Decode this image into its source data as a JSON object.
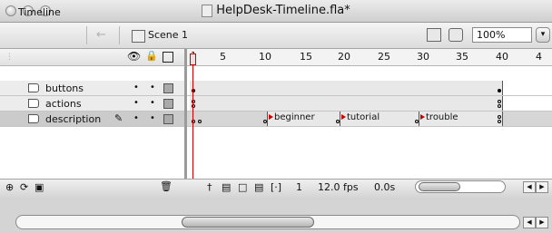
{
  "window": {
    "title": "HelpDesk-Timeline.fla*"
  },
  "toolbar": {
    "panel_tab": "Timeline",
    "scene_label": "Scene 1",
    "zoom_value": "100%"
  },
  "layer_header": {
    "eye_icon": "eye-icon",
    "lock_icon": "lock-icon",
    "outline_icon": "outline-square-icon"
  },
  "layers": [
    {
      "name": "buttons"
    },
    {
      "name": "actions"
    },
    {
      "name": "description"
    }
  ],
  "ruler": {
    "ticks": [
      "1",
      "5",
      "10",
      "15",
      "20",
      "25",
      "30",
      "35",
      "40",
      "4"
    ]
  },
  "frame_labels": [
    "beginner",
    "tutorial",
    "trouble"
  ],
  "status": {
    "current_frame": "1",
    "frame_rate": "12.0 fps",
    "elapsed_time": "0.0s"
  },
  "colors": {
    "playhead": "#cc0000",
    "selected_layer": "#cbcbcb"
  }
}
